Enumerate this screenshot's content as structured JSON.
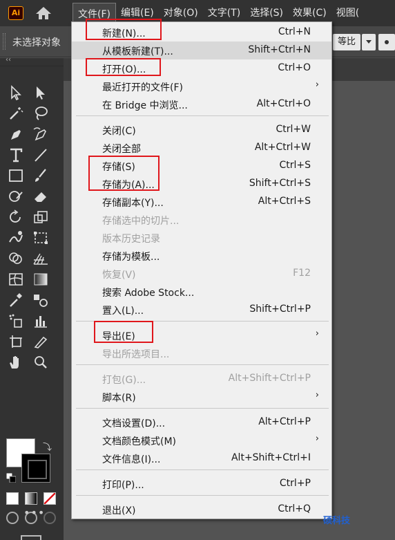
{
  "app": {
    "logo": "Ai"
  },
  "menubar": {
    "items": [
      "文件(F)",
      "编辑(E)",
      "对象(O)",
      "文字(T)",
      "选择(S)",
      "效果(C)",
      "视图("
    ]
  },
  "controlbar": {
    "selection_text": "未选择对象",
    "ratio_label": "等比"
  },
  "toolbar": {
    "collapse_glyph": "‹‹",
    "more_glyph": "•••"
  },
  "file_menu": {
    "items": [
      {
        "label": "新建(N)...",
        "shortcut": "Ctrl+N",
        "disabled": false
      },
      {
        "label": "从模板新建(T)...",
        "shortcut": "Shift+Ctrl+N",
        "disabled": false
      },
      {
        "label": "打开(O)...",
        "shortcut": "Ctrl+O",
        "disabled": false
      },
      {
        "label": "最近打开的文件(F)",
        "shortcut": "",
        "submenu": true
      },
      {
        "label": "在 Bridge 中浏览...",
        "shortcut": "Alt+Ctrl+O",
        "disabled": false
      },
      {
        "label": "关闭(C)",
        "shortcut": "Ctrl+W",
        "disabled": false
      },
      {
        "label": "关闭全部",
        "shortcut": "Alt+Ctrl+W",
        "disabled": false
      },
      {
        "label": "存储(S)",
        "shortcut": "Ctrl+S",
        "disabled": false
      },
      {
        "label": "存储为(A)...",
        "shortcut": "Shift+Ctrl+S",
        "disabled": false
      },
      {
        "label": "存储副本(Y)...",
        "shortcut": "Alt+Ctrl+S",
        "disabled": false
      },
      {
        "label": "存储选中的切片...",
        "shortcut": "",
        "disabled": true
      },
      {
        "label": "版本历史记录",
        "shortcut": "",
        "disabled": true
      },
      {
        "label": "存储为模板...",
        "shortcut": "",
        "disabled": false
      },
      {
        "label": "恢复(V)",
        "shortcut": "F12",
        "disabled": true
      },
      {
        "label": "搜索 Adobe Stock...",
        "shortcut": "",
        "disabled": false
      },
      {
        "label": "置入(L)...",
        "shortcut": "Shift+Ctrl+P",
        "disabled": false
      },
      {
        "label": "导出(E)",
        "shortcut": "",
        "submenu": true
      },
      {
        "label": "导出所选项目...",
        "shortcut": "",
        "disabled": true
      },
      {
        "label": "打包(G)...",
        "shortcut": "Alt+Shift+Ctrl+P",
        "disabled": true
      },
      {
        "label": "脚本(R)",
        "shortcut": "",
        "submenu": true
      },
      {
        "label": "文档设置(D)...",
        "shortcut": "Alt+Ctrl+P",
        "disabled": false
      },
      {
        "label": "文档颜色模式(M)",
        "shortcut": "",
        "submenu": true
      },
      {
        "label": "文件信息(I)...",
        "shortcut": "Alt+Shift+Ctrl+I",
        "disabled": false
      },
      {
        "label": "打印(P)...",
        "shortcut": "Ctrl+P",
        "disabled": false
      },
      {
        "label": "退出(X)",
        "shortcut": "Ctrl+Q",
        "disabled": false
      }
    ],
    "submenu_glyph": "›"
  },
  "watermark": {
    "text": "硕科技"
  },
  "colors": {
    "highlight": "#e0161b",
    "menu_bg": "#f0f0f0",
    "ui_dark": "#323232"
  }
}
